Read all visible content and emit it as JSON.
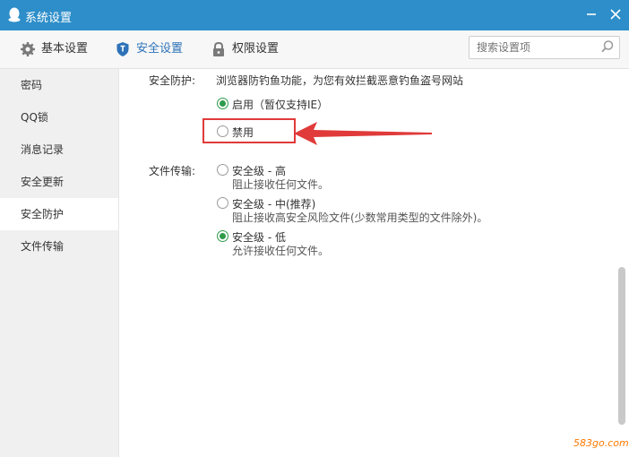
{
  "window": {
    "title": "系统设置"
  },
  "topnav": {
    "tabs": [
      {
        "label": "基本设置",
        "icon": "gear-icon"
      },
      {
        "label": "安全设置",
        "icon": "shield-icon",
        "active": true
      },
      {
        "label": "权限设置",
        "icon": "lock-icon"
      }
    ],
    "search": {
      "placeholder": "搜索设置项",
      "value": ""
    }
  },
  "sidebar": {
    "items": [
      {
        "label": "密码"
      },
      {
        "label": "QQ锁"
      },
      {
        "label": "消息记录"
      },
      {
        "label": "安全更新"
      },
      {
        "label": "安全防护",
        "active": true
      },
      {
        "label": "文件传输"
      }
    ]
  },
  "content": {
    "protection": {
      "label": "安全防护:",
      "description": "浏览器防钓鱼功能，为您有效拦截恶意钓鱼盗号网站",
      "options": [
        {
          "label": "启用（暂仅支持IE）",
          "checked": true
        },
        {
          "label": "禁用",
          "checked": false
        }
      ]
    },
    "file_transfer": {
      "label": "文件传输:",
      "options": [
        {
          "label": "安全级 - 高",
          "desc": "阻止接收任何文件。",
          "checked": false
        },
        {
          "label": "安全级 - 中(推荐)",
          "desc": "阻止接收高安全风险文件(少数常用类型的文件除外)。",
          "checked": false
        },
        {
          "label": "安全级 - 低",
          "desc": "允许接收任何文件。",
          "checked": true
        }
      ]
    }
  },
  "watermark": "583go.com",
  "colors": {
    "titlebar": "#2d8ec9",
    "accent": "#2d72b8",
    "radio_checked": "#2e9b4b",
    "highlight": "#e03a3a"
  }
}
